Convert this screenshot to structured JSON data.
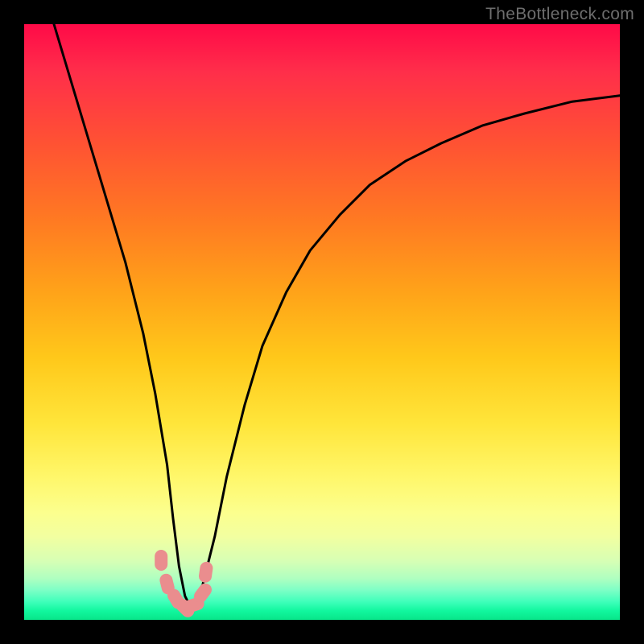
{
  "watermark": "TheBottleneck.com",
  "colors": {
    "background": "#000000",
    "curve": "#000000",
    "markers": "#ea8d8e"
  },
  "chart_data": {
    "type": "line",
    "title": "",
    "xlabel": "",
    "ylabel": "",
    "xlim": [
      0,
      100
    ],
    "ylim": [
      0,
      100
    ],
    "curve": {
      "x": [
        5,
        8,
        11,
        14,
        17,
        20,
        22,
        24,
        25,
        26,
        27,
        28,
        29,
        30,
        32,
        34,
        37,
        40,
        44,
        48,
        53,
        58,
        64,
        70,
        77,
        84,
        92,
        100
      ],
      "y": [
        100,
        90,
        80,
        70,
        60,
        48,
        38,
        26,
        17,
        9,
        4,
        2,
        3,
        6,
        14,
        24,
        36,
        46,
        55,
        62,
        68,
        73,
        77,
        80,
        83,
        85,
        87,
        88
      ]
    },
    "markers": {
      "x": [
        23.0,
        24.0,
        25.5,
        27.0,
        28.5,
        30.0,
        30.5
      ],
      "y": [
        10.0,
        6.0,
        3.5,
        2.0,
        2.5,
        4.5,
        8.0
      ]
    },
    "note": "x and y are in percent of plot area; y=0 at bottom (green), y=100 at top (red). Values estimated from pixels."
  }
}
